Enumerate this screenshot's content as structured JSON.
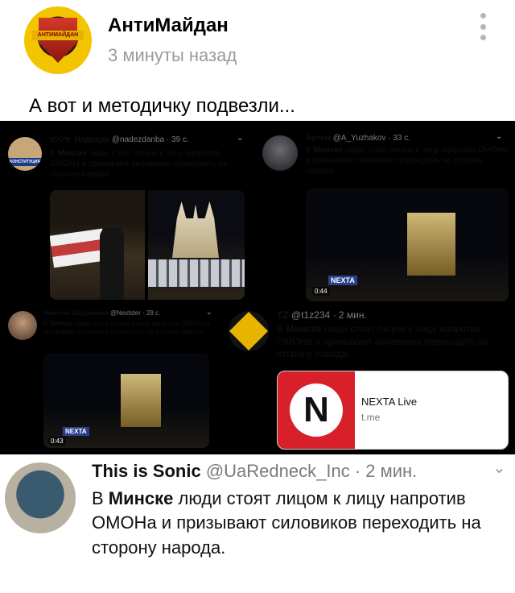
{
  "header": {
    "channel_name": "АнтиМайдан",
    "time": "3 минуты назад",
    "avatar_text": "АНТИМАЙДАН"
  },
  "post": {
    "text": "А вот и методичку подвезли..."
  },
  "tweets": [
    {
      "name": "෨ൗ_Надежда",
      "handle": "@nadezdanba",
      "time": "· 39 с.",
      "avatar_text": "КОНСТИТУЦИЯ",
      "text_bold": "Минске",
      "text_pre": "В ",
      "text_post": " люди стоят лицом к лицу напротив ОМОНа и призывают силовиков переходить на сторону народа."
    },
    {
      "name": "Артем",
      "handle": "@A_Yuzhakov",
      "time": "· 33 с.",
      "text_pre": "В ",
      "text_bold": "Минске",
      "text_post": " люди стоят лицом к лицу напротив ОМОНа и призывают силовиков переходить на сторону народа.",
      "duration": "0:44",
      "sign": "NEXTA"
    },
    {
      "name": "Николай Евдокимов",
      "handle": "@Nextster",
      "time": "· 29 с.",
      "text_pre": "В ",
      "text_bold": "Минске",
      "text_post": " люди стоят лицом к лицу напротив ОМОНа и призывают силовиков переходить на сторону народа.",
      "duration": "0:43",
      "sign": "NEXTA"
    },
    {
      "name": "TZ",
      "handle": "@t1z234",
      "time": "· 2 мин.",
      "text_pre": "В ",
      "text_bold": "Минске",
      "text_post": " люди стоят лицом к лицу напротив ОМОНа и призывают силовиков переходить на сторону народа.",
      "card_title": "NEXTA Live",
      "card_domain": "t.me"
    },
    {
      "name": "This is Sonic",
      "handle": "@UaRedneck_Inc",
      "time": "· 2 мин.",
      "text_pre": "В ",
      "text_bold": "Минске",
      "text_post": " люди стоят лицом к лицу напротив ОМОНа и призывают силовиков переходить на сторону народа."
    }
  ],
  "colors": {
    "muted": "#9a9a9a",
    "twitter_grey": "#7b7b7b",
    "nexta_red": "#d8202a"
  },
  "icons": {
    "menu": "more-vertical-icon",
    "chevron": "chevron-down-icon"
  }
}
